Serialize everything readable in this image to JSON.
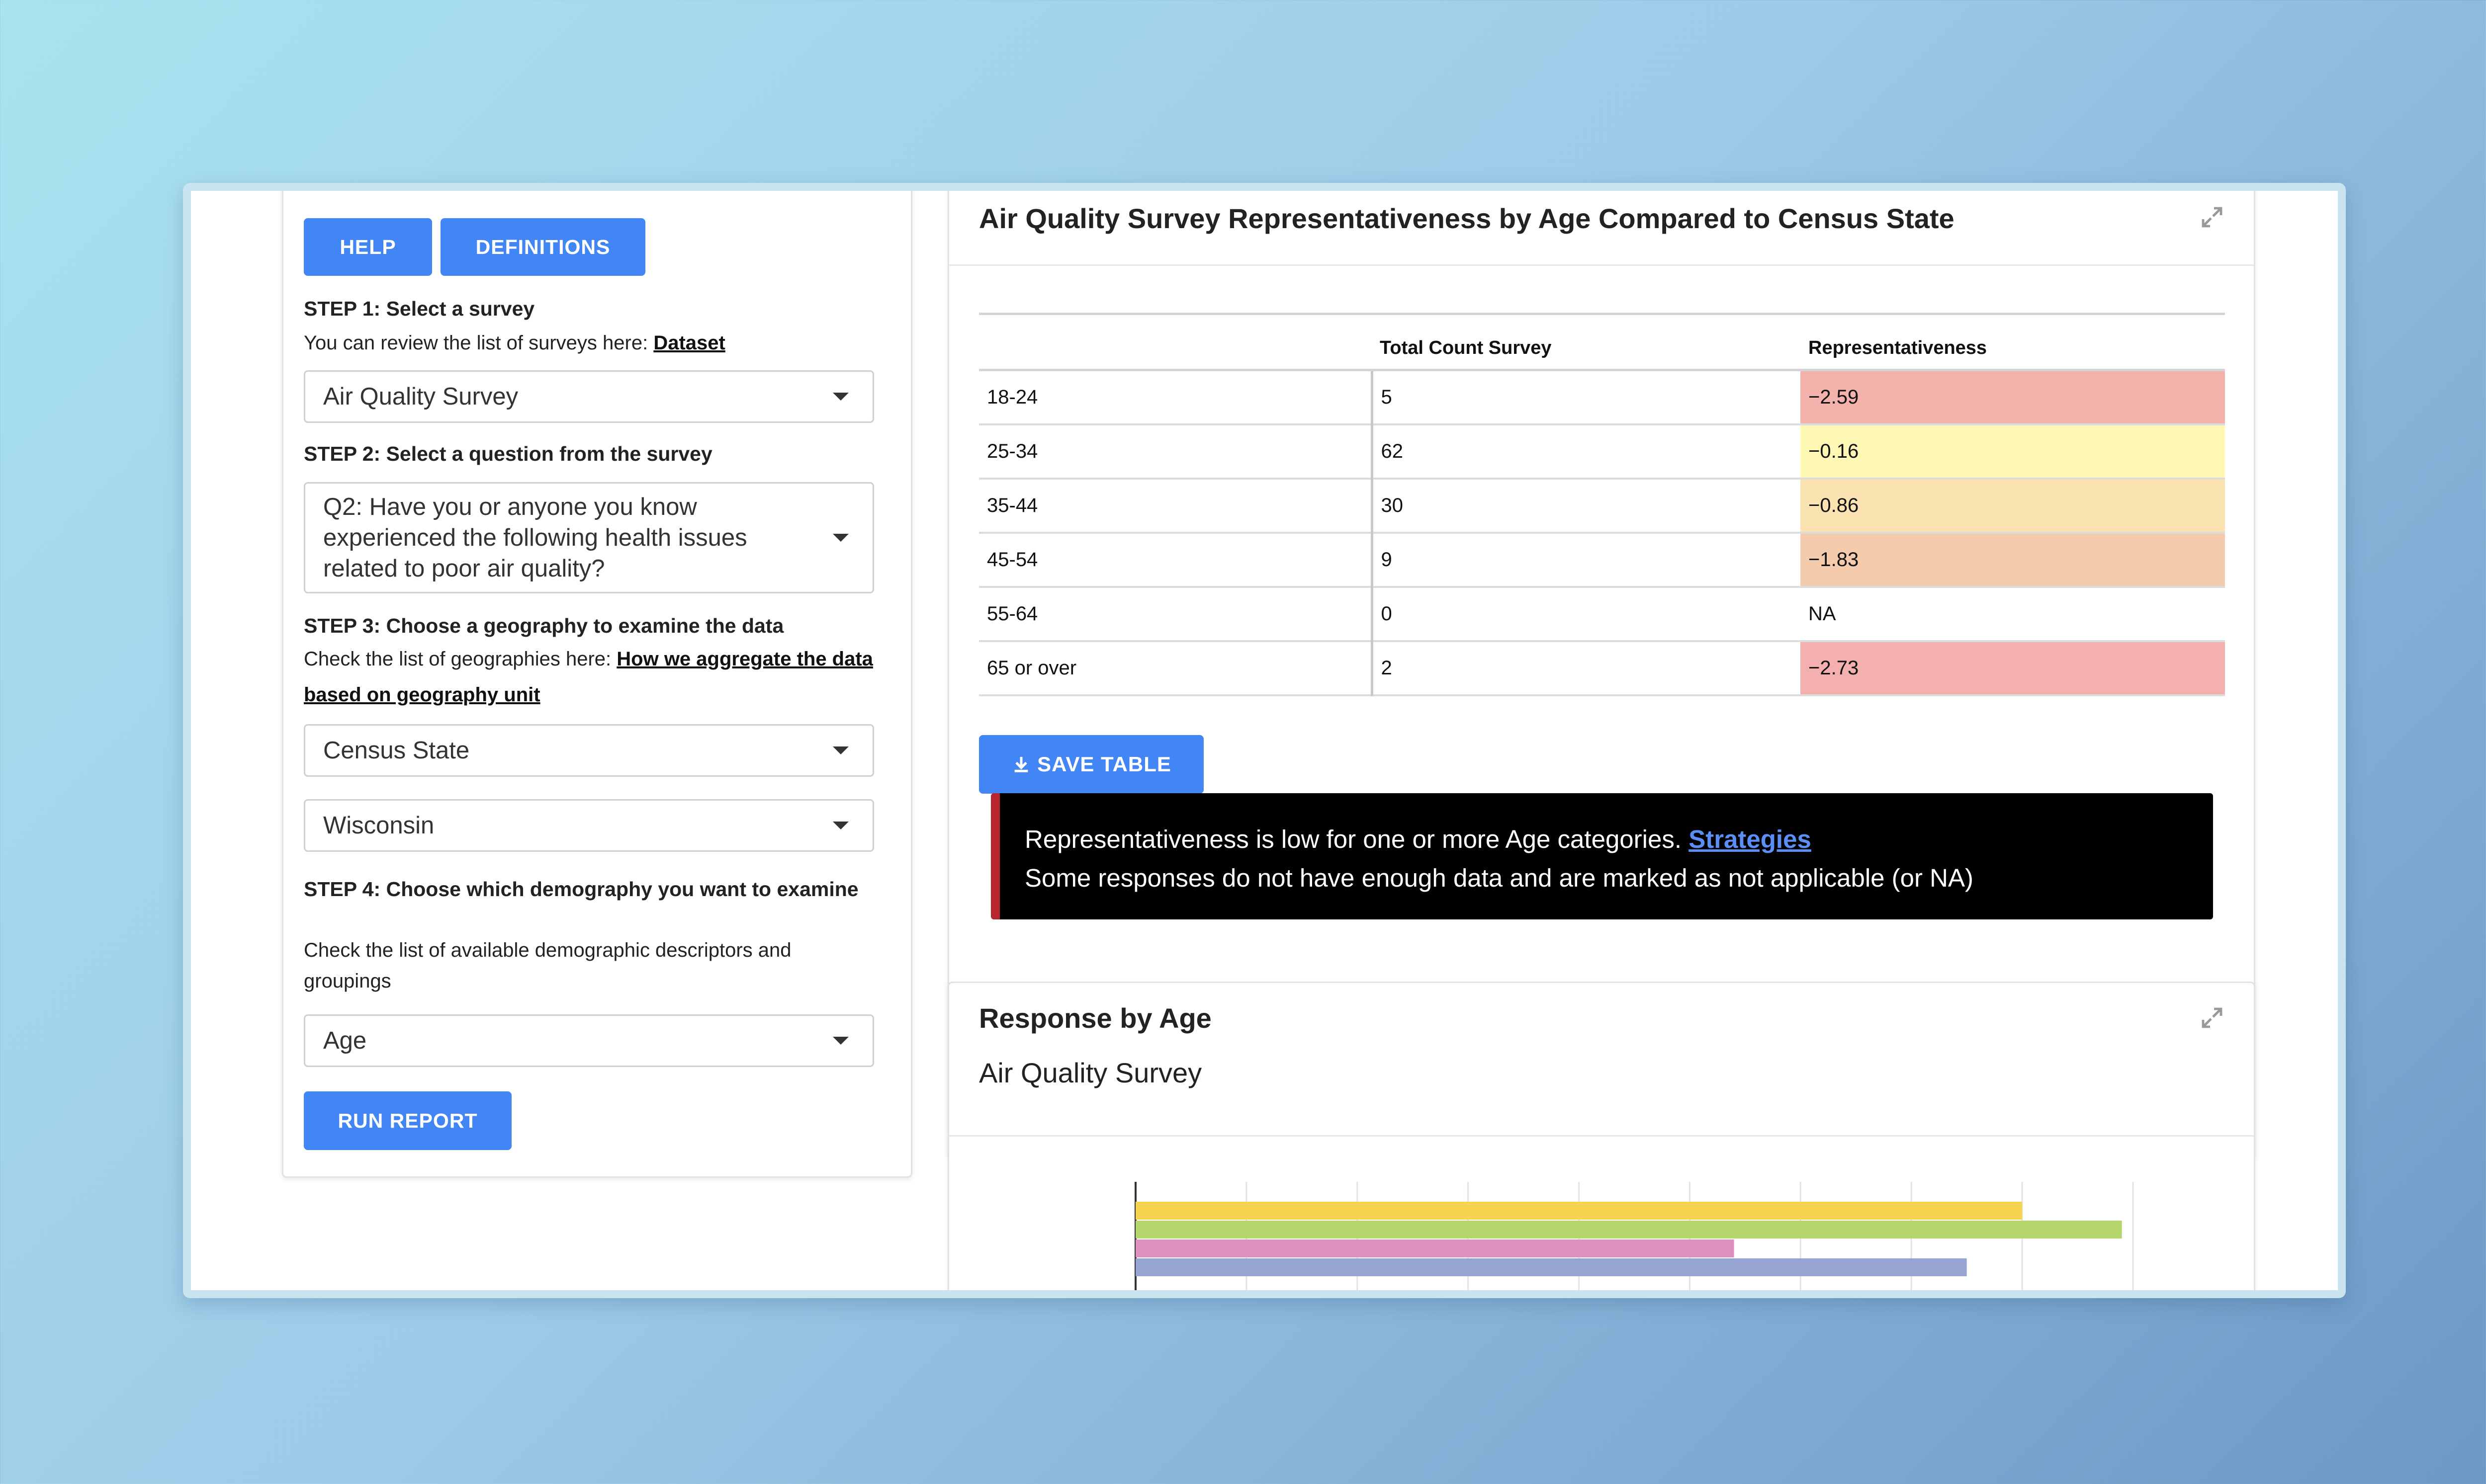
{
  "sidebar": {
    "help_label": "HELP",
    "definitions_label": "DEFINITIONS",
    "step1": {
      "title": "STEP 1: Select a survey",
      "text": "You can review the list of surveys here: ",
      "link": "Dataset",
      "selected": "Air Quality Survey"
    },
    "step2": {
      "title": "STEP 2: Select a question from the survey",
      "selected": "Q2: Have you or anyone you know experienced the following health issues related to poor air quality?"
    },
    "step3": {
      "title": "STEP 3: Choose a geography to examine the data",
      "text": "Check the list of geographies here: ",
      "link": "How we aggregate the data based on geography unit",
      "geography_selected": "Census State",
      "state_selected": "Wisconsin"
    },
    "step4": {
      "title": "STEP 4: Choose which demography you want to examine",
      "text": "Check the list of available demographic descriptors and groupings",
      "selected": "Age"
    },
    "run_label": "RUN REPORT"
  },
  "rep_card": {
    "title": "Air Quality Survey Representativeness by Age Compared to Census State",
    "columns": [
      "",
      "Total Count Survey",
      "Representativeness"
    ],
    "rows": [
      {
        "age": "18-24",
        "count": "5",
        "rep": "−2.59",
        "color": "#f3b3ac"
      },
      {
        "age": "25-34",
        "count": "62",
        "rep": "−0.16",
        "color": "#fff7b4"
      },
      {
        "age": "35-44",
        "count": "30",
        "rep": "−0.86",
        "color": "#fbe3b1"
      },
      {
        "age": "45-54",
        "count": "9",
        "rep": "−1.83",
        "color": "#f5cbae"
      },
      {
        "age": "55-64",
        "count": "0",
        "rep": "NA",
        "color": "#ffffff"
      },
      {
        "age": "65 or over",
        "count": "2",
        "rep": "−2.73",
        "color": "#f4b0af"
      }
    ],
    "save_label": "SAVE TABLE",
    "alert": {
      "line1": "Representativeness is low for one or more Age categories. ",
      "link": "Strategies",
      "line2": "Some responses do not have enough data and are marked as not applicable (or NA)"
    }
  },
  "response_card": {
    "title": "Response by Age",
    "subtitle": "Air Quality Survey"
  },
  "chart_data": {
    "type": "bar",
    "orientation": "horizontal",
    "series": [
      {
        "values": [
          80
        ],
        "color": "#f6d44f"
      },
      {
        "values": [
          89
        ],
        "color": "#b5d66c"
      },
      {
        "values": [
          54
        ],
        "color": "#dd90c0"
      },
      {
        "values": [
          75
        ],
        "color": "#96a4d4"
      }
    ],
    "xlim": [
      0,
      90
    ],
    "grid": true
  },
  "colors": {
    "accent": "#4285f4",
    "alert_bg": "#000000",
    "alert_border": "#b7252e"
  }
}
